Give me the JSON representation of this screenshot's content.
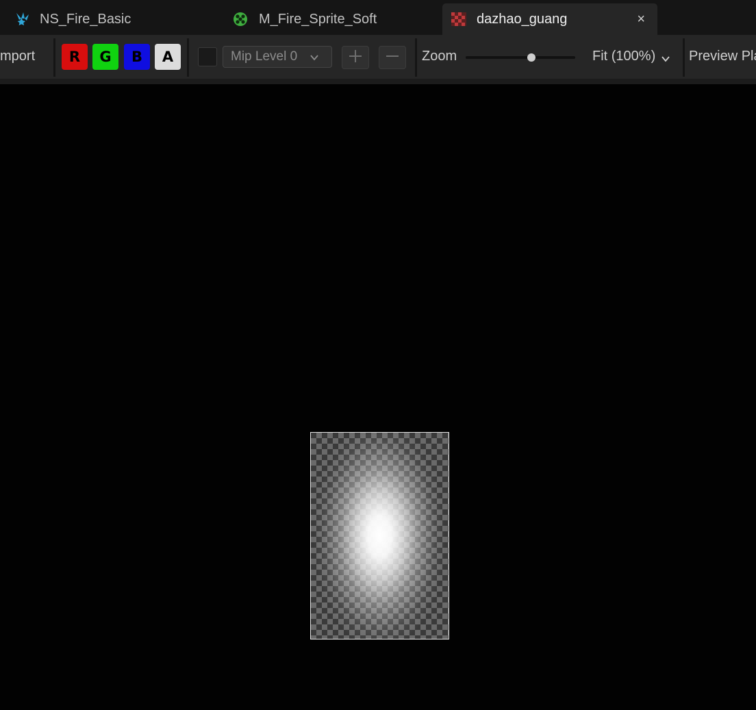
{
  "tabs": [
    {
      "label": "NS_Fire_Basic",
      "icon": "niagara-system-icon",
      "active": false
    },
    {
      "label": "M_Fire_Sprite_Soft",
      "icon": "material-icon",
      "active": false
    },
    {
      "label": "dazhao_guang",
      "icon": "texture-icon",
      "active": true,
      "close_glyph": "×"
    }
  ],
  "toolbar": {
    "import_label": "mport",
    "channels": {
      "r": "R",
      "g": "G",
      "b": "B",
      "a": "A"
    },
    "mip_level": "Mip Level 0",
    "zoom_label": "Zoom",
    "zoom_fraction": 0.6,
    "fit_label": "Fit (100%)",
    "preview_label": "Preview Pla"
  },
  "colors": {
    "channel_r": "#d80e0e",
    "channel_g": "#10d210",
    "channel_b": "#0f0ee0",
    "channel_a": "#dcdcdc",
    "niagara_accent": "#2fa6d8",
    "material_accent": "#3fae3f",
    "texture_accent": "#c0393b"
  }
}
